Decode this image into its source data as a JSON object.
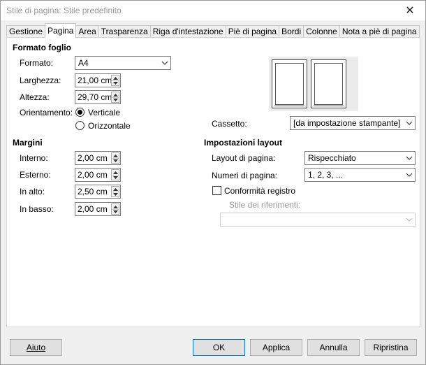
{
  "window": {
    "title": "Stile di pagina: Stile predefinito",
    "close_glyph": "✕"
  },
  "tabs": [
    {
      "label": "Gestione"
    },
    {
      "label": "Pagina"
    },
    {
      "label": "Area"
    },
    {
      "label": "Trasparenza"
    },
    {
      "label": "Riga d'intestazione"
    },
    {
      "label": "Piè di pagina"
    },
    {
      "label": "Bordi"
    },
    {
      "label": "Colonne"
    },
    {
      "label": "Nota a piè di pagina"
    }
  ],
  "formato_foglio": {
    "title": "Formato foglio",
    "formato_label": "Formato:",
    "formato_value": "A4",
    "larghezza_label": "Larghezza:",
    "larghezza_value": "21,00 cm",
    "altezza_label": "Altezza:",
    "altezza_value": "29,70 cm",
    "orientamento_label": "Orientamento:",
    "verticale_label": "Verticale",
    "orizzontale_label": "Orizzontale"
  },
  "margini": {
    "title": "Margini",
    "interno_label": "Interno:",
    "interno_value": "2,00 cm",
    "esterno_label": "Esterno:",
    "esterno_value": "2,00 cm",
    "in_alto_label": "In alto:",
    "in_alto_value": "2,50 cm",
    "in_basso_label": "In basso:",
    "in_basso_value": "2,00 cm"
  },
  "cassetto": {
    "label": "Cassetto:",
    "value": "[da impostazione stampante]"
  },
  "impostazioni_layout": {
    "title": "Impostazioni layout",
    "layout_label": "Layout di pagina:",
    "layout_value": "Rispecchiato",
    "numeri_label": "Numeri di pagina:",
    "numeri_value": "1, 2, 3, ...",
    "conformita_label": "Conformità registro",
    "stile_label": "Stile dei riferimenti:",
    "stile_value": ""
  },
  "buttons": {
    "aiuto": "Aiuto",
    "ok": "OK",
    "applica": "Applica",
    "annulla": "Annulla",
    "ripristina": "Ripristina"
  },
  "colors": {
    "default_button_border": "#0078d7",
    "disabled_text": "#999999"
  }
}
